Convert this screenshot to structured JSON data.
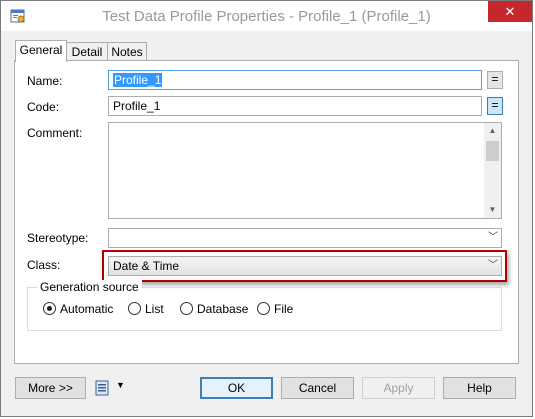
{
  "window": {
    "title": "Test Data Profile Properties - Profile_1 (Profile_1)",
    "close_icon": "close-icon",
    "app_icon": "properties-app-icon"
  },
  "tabs": [
    {
      "label": "General",
      "active": true
    },
    {
      "label": "Detail",
      "active": false
    },
    {
      "label": "Notes",
      "active": false
    }
  ],
  "form": {
    "name_label": "Name:",
    "name_value": "Profile_1",
    "name_eq": "=",
    "code_label": "Code:",
    "code_value": "Profile_1",
    "code_eq": "=",
    "comment_label": "Comment:",
    "comment_value": "",
    "stereotype_label": "Stereotype:",
    "stereotype_value": "",
    "class_label": "Class:",
    "class_value": "Date & Time"
  },
  "generation_source": {
    "title": "Generation source",
    "options": [
      {
        "label": "Automatic",
        "selected": true
      },
      {
        "label": "List",
        "selected": false
      },
      {
        "label": "Database",
        "selected": false
      },
      {
        "label": "File",
        "selected": false
      }
    ]
  },
  "buttons": {
    "more": "More >>",
    "ok": "OK",
    "cancel": "Cancel",
    "apply": "Apply",
    "help": "Help"
  },
  "colors": {
    "close_button": "#c7262b",
    "highlight_border": "#b00000",
    "selection": "#3399ff"
  }
}
